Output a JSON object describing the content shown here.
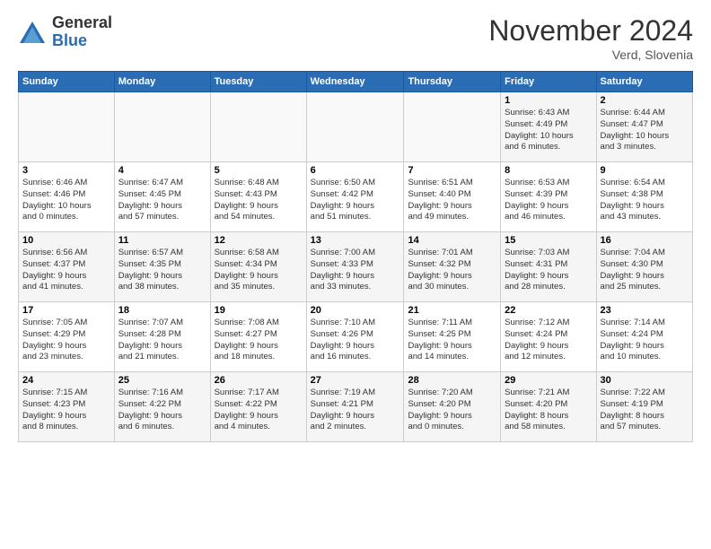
{
  "logo": {
    "general": "General",
    "blue": "Blue"
  },
  "header": {
    "title": "November 2024",
    "location": "Verd, Slovenia"
  },
  "weekdays": [
    "Sunday",
    "Monday",
    "Tuesday",
    "Wednesday",
    "Thursday",
    "Friday",
    "Saturday"
  ],
  "weeks": [
    [
      {
        "day": "",
        "info": ""
      },
      {
        "day": "",
        "info": ""
      },
      {
        "day": "",
        "info": ""
      },
      {
        "day": "",
        "info": ""
      },
      {
        "day": "",
        "info": ""
      },
      {
        "day": "1",
        "info": "Sunrise: 6:43 AM\nSunset: 4:49 PM\nDaylight: 10 hours\nand 6 minutes."
      },
      {
        "day": "2",
        "info": "Sunrise: 6:44 AM\nSunset: 4:47 PM\nDaylight: 10 hours\nand 3 minutes."
      }
    ],
    [
      {
        "day": "3",
        "info": "Sunrise: 6:46 AM\nSunset: 4:46 PM\nDaylight: 10 hours\nand 0 minutes."
      },
      {
        "day": "4",
        "info": "Sunrise: 6:47 AM\nSunset: 4:45 PM\nDaylight: 9 hours\nand 57 minutes."
      },
      {
        "day": "5",
        "info": "Sunrise: 6:48 AM\nSunset: 4:43 PM\nDaylight: 9 hours\nand 54 minutes."
      },
      {
        "day": "6",
        "info": "Sunrise: 6:50 AM\nSunset: 4:42 PM\nDaylight: 9 hours\nand 51 minutes."
      },
      {
        "day": "7",
        "info": "Sunrise: 6:51 AM\nSunset: 4:40 PM\nDaylight: 9 hours\nand 49 minutes."
      },
      {
        "day": "8",
        "info": "Sunrise: 6:53 AM\nSunset: 4:39 PM\nDaylight: 9 hours\nand 46 minutes."
      },
      {
        "day": "9",
        "info": "Sunrise: 6:54 AM\nSunset: 4:38 PM\nDaylight: 9 hours\nand 43 minutes."
      }
    ],
    [
      {
        "day": "10",
        "info": "Sunrise: 6:56 AM\nSunset: 4:37 PM\nDaylight: 9 hours\nand 41 minutes."
      },
      {
        "day": "11",
        "info": "Sunrise: 6:57 AM\nSunset: 4:35 PM\nDaylight: 9 hours\nand 38 minutes."
      },
      {
        "day": "12",
        "info": "Sunrise: 6:58 AM\nSunset: 4:34 PM\nDaylight: 9 hours\nand 35 minutes."
      },
      {
        "day": "13",
        "info": "Sunrise: 7:00 AM\nSunset: 4:33 PM\nDaylight: 9 hours\nand 33 minutes."
      },
      {
        "day": "14",
        "info": "Sunrise: 7:01 AM\nSunset: 4:32 PM\nDaylight: 9 hours\nand 30 minutes."
      },
      {
        "day": "15",
        "info": "Sunrise: 7:03 AM\nSunset: 4:31 PM\nDaylight: 9 hours\nand 28 minutes."
      },
      {
        "day": "16",
        "info": "Sunrise: 7:04 AM\nSunset: 4:30 PM\nDaylight: 9 hours\nand 25 minutes."
      }
    ],
    [
      {
        "day": "17",
        "info": "Sunrise: 7:05 AM\nSunset: 4:29 PM\nDaylight: 9 hours\nand 23 minutes."
      },
      {
        "day": "18",
        "info": "Sunrise: 7:07 AM\nSunset: 4:28 PM\nDaylight: 9 hours\nand 21 minutes."
      },
      {
        "day": "19",
        "info": "Sunrise: 7:08 AM\nSunset: 4:27 PM\nDaylight: 9 hours\nand 18 minutes."
      },
      {
        "day": "20",
        "info": "Sunrise: 7:10 AM\nSunset: 4:26 PM\nDaylight: 9 hours\nand 16 minutes."
      },
      {
        "day": "21",
        "info": "Sunrise: 7:11 AM\nSunset: 4:25 PM\nDaylight: 9 hours\nand 14 minutes."
      },
      {
        "day": "22",
        "info": "Sunrise: 7:12 AM\nSunset: 4:24 PM\nDaylight: 9 hours\nand 12 minutes."
      },
      {
        "day": "23",
        "info": "Sunrise: 7:14 AM\nSunset: 4:24 PM\nDaylight: 9 hours\nand 10 minutes."
      }
    ],
    [
      {
        "day": "24",
        "info": "Sunrise: 7:15 AM\nSunset: 4:23 PM\nDaylight: 9 hours\nand 8 minutes."
      },
      {
        "day": "25",
        "info": "Sunrise: 7:16 AM\nSunset: 4:22 PM\nDaylight: 9 hours\nand 6 minutes."
      },
      {
        "day": "26",
        "info": "Sunrise: 7:17 AM\nSunset: 4:22 PM\nDaylight: 9 hours\nand 4 minutes."
      },
      {
        "day": "27",
        "info": "Sunrise: 7:19 AM\nSunset: 4:21 PM\nDaylight: 9 hours\nand 2 minutes."
      },
      {
        "day": "28",
        "info": "Sunrise: 7:20 AM\nSunset: 4:20 PM\nDaylight: 9 hours\nand 0 minutes."
      },
      {
        "day": "29",
        "info": "Sunrise: 7:21 AM\nSunset: 4:20 PM\nDaylight: 8 hours\nand 58 minutes."
      },
      {
        "day": "30",
        "info": "Sunrise: 7:22 AM\nSunset: 4:19 PM\nDaylight: 8 hours\nand 57 minutes."
      }
    ]
  ]
}
